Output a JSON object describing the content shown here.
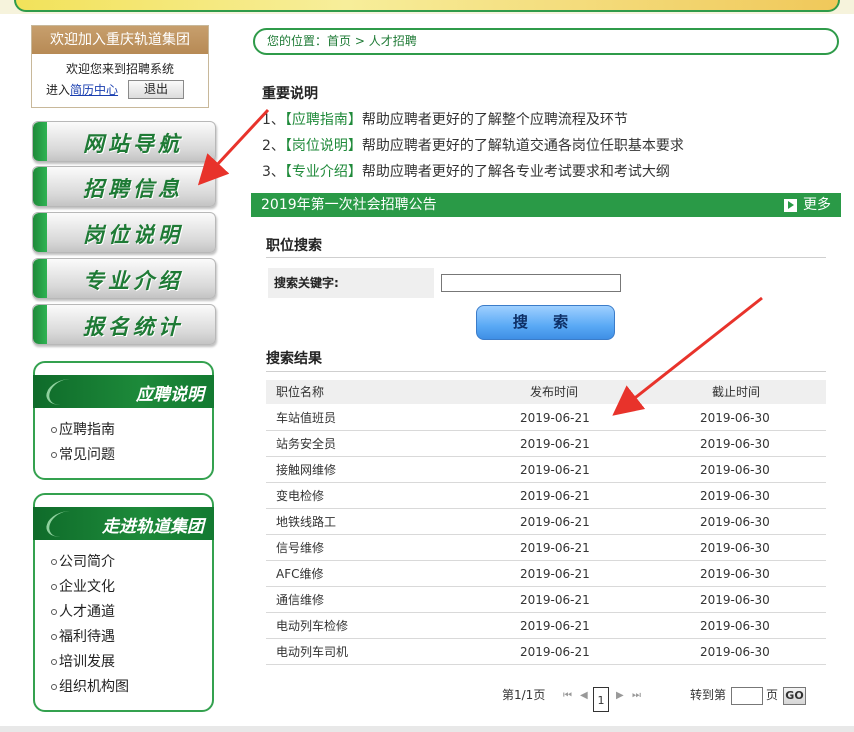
{
  "welcome": {
    "title": "欢迎加入重庆轨道集团",
    "line1": "欢迎您来到招聘系统",
    "enter_prefix": "进入",
    "resume_link": "简历中心",
    "logout_label": "退出"
  },
  "nav": [
    "网站导航",
    "招聘信息",
    "岗位说明",
    "专业介绍",
    "报名统计"
  ],
  "panels": {
    "guide": {
      "title": "应聘说明",
      "items": [
        "应聘指南",
        "常见问题"
      ]
    },
    "about": {
      "title": "走进轨道集团",
      "items": [
        "公司简介",
        "企业文化",
        "人才通道",
        "福利待遇",
        "培训发展",
        "组织机构图"
      ]
    }
  },
  "breadcrumb": {
    "prefix": "您的位置：",
    "home": "首页",
    "sep": " > ",
    "current": "人才招聘"
  },
  "notes": {
    "title": "重要说明",
    "items": [
      {
        "num": "1、",
        "tag": "【应聘指南】",
        "text": "帮助应聘者更好的了解整个应聘流程及环节"
      },
      {
        "num": "2、",
        "tag": "【岗位说明】",
        "text": "帮助应聘者更好的了解轨道交通各岗位任职基本要求"
      },
      {
        "num": "3、",
        "tag": "【专业介绍】",
        "text": "帮助应聘者更好的了解各专业考试要求和考试大纲"
      }
    ]
  },
  "announcement": {
    "title": "2019年第一次社会招聘公告",
    "more": "更多"
  },
  "search": {
    "section_title": "职位搜索",
    "label": "搜索关键字:",
    "value": "",
    "button": "搜 索"
  },
  "results": {
    "section_title": "搜索结果",
    "headers": [
      "职位名称",
      "发布时间",
      "截止时间"
    ],
    "rows": [
      [
        "车站值班员",
        "2019-06-21",
        "2019-06-30"
      ],
      [
        "站务安全员",
        "2019-06-21",
        "2019-06-30"
      ],
      [
        "接触网维修",
        "2019-06-21",
        "2019-06-30"
      ],
      [
        "变电检修",
        "2019-06-21",
        "2019-06-30"
      ],
      [
        "地铁线路工",
        "2019-06-21",
        "2019-06-30"
      ],
      [
        "信号维修",
        "2019-06-21",
        "2019-06-30"
      ],
      [
        "AFC维修",
        "2019-06-21",
        "2019-06-30"
      ],
      [
        "通信维修",
        "2019-06-21",
        "2019-06-30"
      ],
      [
        "电动列车检修",
        "2019-06-21",
        "2019-06-30"
      ],
      [
        "电动列车司机",
        "2019-06-21",
        "2019-06-30"
      ]
    ]
  },
  "pager": {
    "summary": "第1/1页",
    "current_page": "1",
    "goto_prefix": "转到第",
    "goto_suffix": "页",
    "go": "GO"
  },
  "colors": {
    "brand_green": "#2a9a47",
    "annotation_red": "#e8332b"
  }
}
